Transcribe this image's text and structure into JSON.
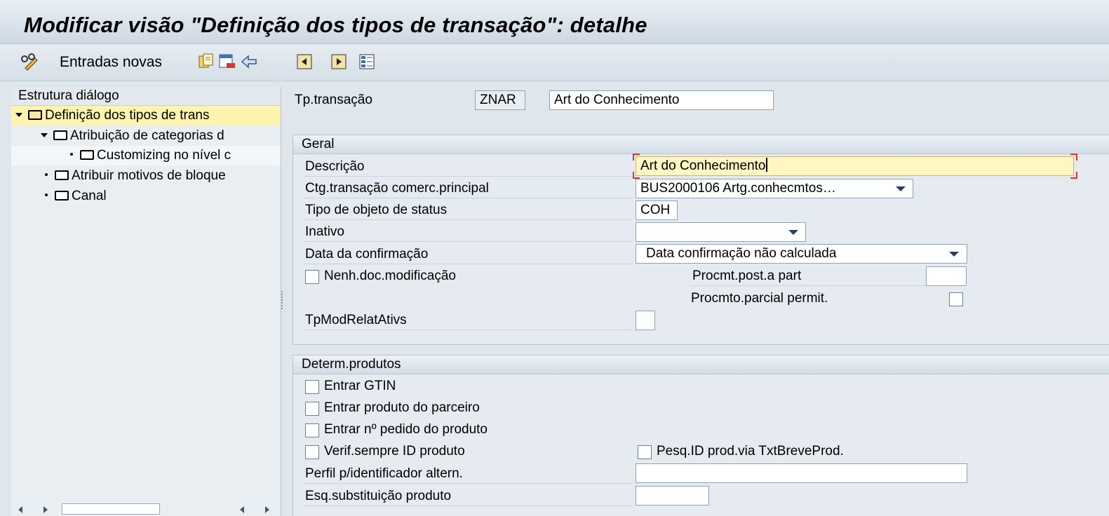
{
  "title": "Modificar visão \"Definição dos tipos de transação\": detalhe",
  "toolbar": {
    "new_entries_label": "Entradas novas",
    "icons": [
      "pencil-glasses-icon",
      "copy-icon",
      "delete-icon",
      "undo-icon",
      "previous-entry-icon",
      "next-entry-icon",
      "select-all-icon"
    ]
  },
  "dialog_structure": {
    "header": "Estrutura diálogo",
    "items": [
      {
        "label": "Definição dos tipos de trans",
        "level": 0,
        "expanded": true,
        "selected": true
      },
      {
        "label": "Atribuição de categorias d",
        "level": 1,
        "expanded": true
      },
      {
        "label": "Customizing no nível c",
        "level": 2
      },
      {
        "label": "Atribuir motivos de bloque",
        "level": 1
      },
      {
        "label": "Canal",
        "level": 1
      }
    ]
  },
  "key": {
    "label": "Tp.transação",
    "value": "ZNAR",
    "description": "Art do Conhecimento"
  },
  "geral": {
    "header": "Geral",
    "descricao_label": "Descrição",
    "descricao_value": "Art do Conhecimento",
    "ctg_label": "Ctg.transação comerc.principal",
    "ctg_value": "BUS2000106 Artg.conhecmtos…",
    "status_label": "Tipo de objeto de status",
    "status_value": "COH",
    "inativo_label": "Inativo",
    "inativo_value": "",
    "data_conf_label": "Data da confirmação",
    "data_conf_value": "Data confirmação não calculada",
    "nenh_doc_label": "Nenh.doc.modificação",
    "procmt_post_label": "Procmt.post.a part",
    "procmt_post_value": "",
    "procmto_parcial_label": "Procmto.parcial permit.",
    "tpmod_label": "TpModRelatAtivs",
    "tpmod_value": ""
  },
  "determ": {
    "header": "Determ.produtos",
    "gtin_label": "Entrar GTIN",
    "parceiro_label": "Entrar produto do parceiro",
    "pedido_label": "Entrar nº pedido do produto",
    "verif_label": "Verif.sempre ID produto",
    "pesq_label": "Pesq.ID prod.via TxtBreveProd.",
    "perfil_label": "Perfil p/identificador altern.",
    "perfil_value": "",
    "esq_label": "Esq.substituição produto",
    "esq_value": ""
  }
}
